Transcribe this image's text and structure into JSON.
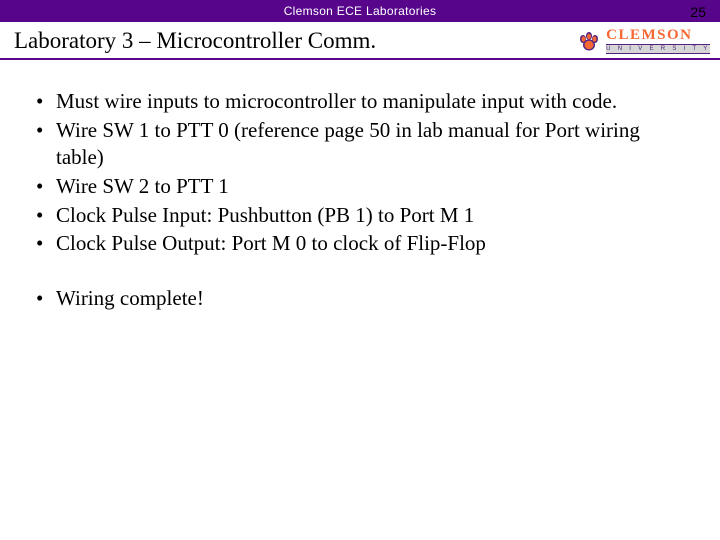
{
  "header": {
    "top_label": "Clemson ECE Laboratories",
    "page_number": "25",
    "title": "Laboratory 3 – Microcontroller Comm.",
    "logo": {
      "word": "CLEMSON",
      "sub": "U N I V E R S I T Y",
      "paw_color_outer": "#52247f",
      "paw_color_inner": "#f66733"
    }
  },
  "bullets": [
    "Must wire inputs to microcontroller to manipulate input with code.",
    "Wire SW 1 to PTT 0 (reference page 50 in lab manual for Port wiring table)",
    "Wire SW 2 to PTT 1",
    "Clock Pulse Input: Pushbutton (PB 1) to Port M 1",
    "Clock Pulse Output: Port M 0 to clock of Flip-Flop"
  ],
  "bullets2": [
    "Wiring complete!"
  ]
}
